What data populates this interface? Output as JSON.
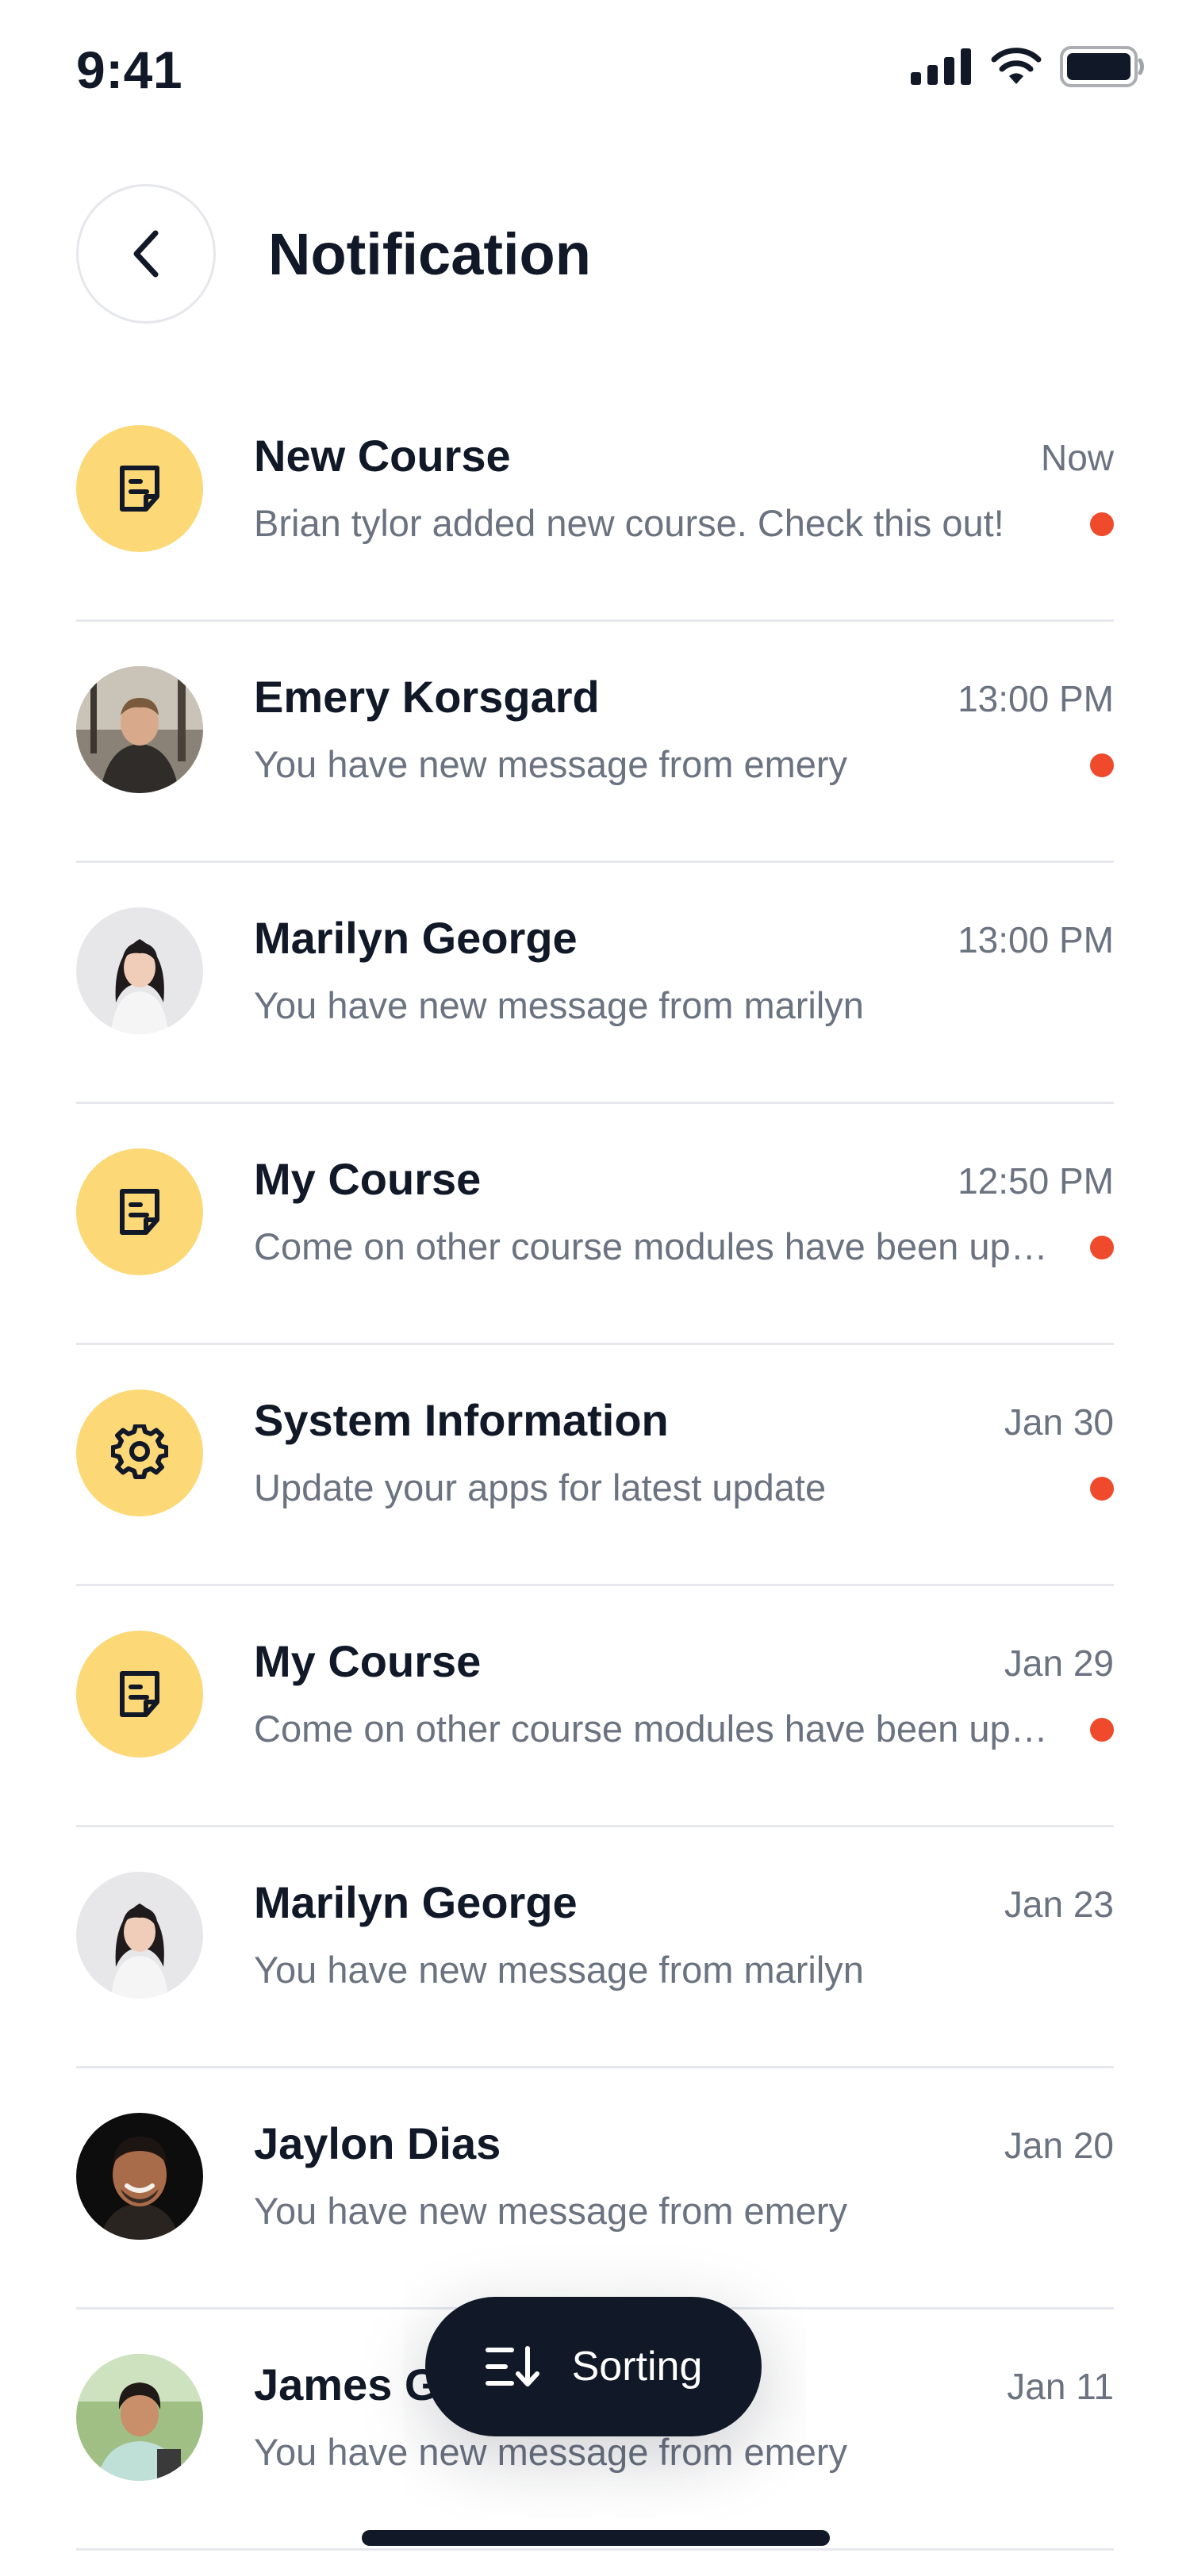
{
  "status_bar": {
    "time": "9:41"
  },
  "header": {
    "title": "Notification"
  },
  "notifications": [
    {
      "type": "icon",
      "icon": "document-icon",
      "title": "New Course",
      "message": "Brian tylor added new course. Check this out!",
      "time": "Now",
      "unread": true
    },
    {
      "type": "avatar",
      "avatar": "man-hoodie",
      "title": "Emery Korsgard",
      "message": "You have new message from emery",
      "time": "13:00 PM",
      "unread": true
    },
    {
      "type": "avatar",
      "avatar": "woman-dark-hair",
      "title": "Marilyn George",
      "message": "You have new message from marilyn",
      "time": "13:00 PM",
      "unread": false
    },
    {
      "type": "icon",
      "icon": "document-icon",
      "title": "My Course",
      "message": "Come on other course modules have been updated",
      "time": "12:50 PM",
      "unread": true
    },
    {
      "type": "icon",
      "icon": "gear-icon",
      "title": "System Information",
      "message": "Update your apps for latest update",
      "time": "Jan 30",
      "unread": true
    },
    {
      "type": "icon",
      "icon": "document-icon",
      "title": "My Course",
      "message": "Come on other course modules have been updated",
      "time": "Jan 29",
      "unread": true
    },
    {
      "type": "avatar",
      "avatar": "woman-dark-hair",
      "title": "Marilyn George",
      "message": "You have new message from marilyn",
      "time": "Jan 23",
      "unread": false
    },
    {
      "type": "avatar",
      "avatar": "smiling-man",
      "title": "Jaylon Dias",
      "message": "You have new message from emery",
      "time": "Jan 20",
      "unread": false
    },
    {
      "type": "avatar",
      "avatar": "man-outdoors",
      "title": "James G",
      "message": "You have new message from emery",
      "time": "Jan 11",
      "unread": false
    }
  ],
  "sort_button": {
    "label": "Sorting",
    "icon": "sort-icon"
  },
  "colors": {
    "accent_yellow": "#fcd877",
    "dark": "#111827",
    "muted": "#6b7280",
    "unread_dot": "#ef4a2b",
    "divider": "#e6e8ee"
  }
}
